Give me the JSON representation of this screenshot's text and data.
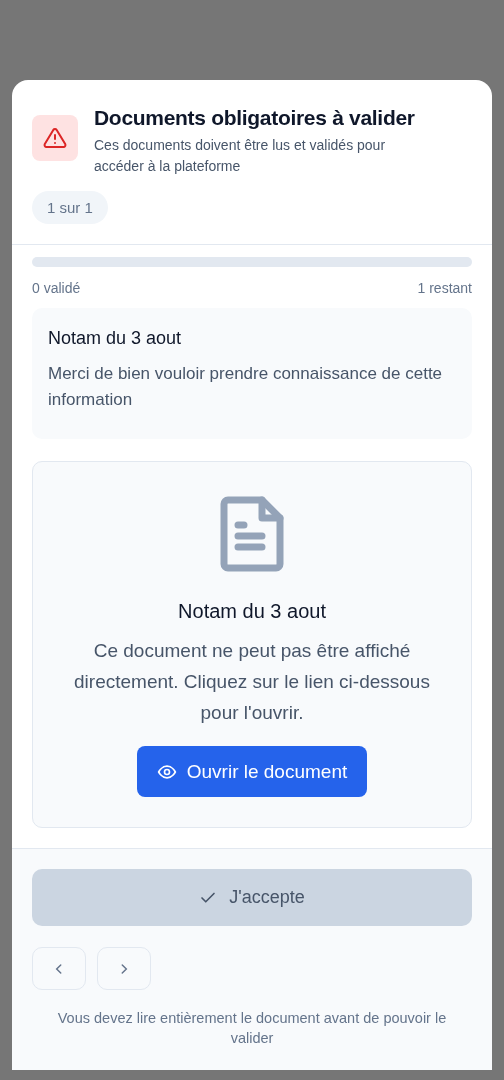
{
  "dialog": {
    "title": "Documents obligatoires à valider",
    "subtitle": "Ces documents doivent être lus et validés pour accéder à la plateforme",
    "counter": "1 sur 1"
  },
  "progress": {
    "level": 0,
    "validated": "0 validé",
    "remaining": "1 restant"
  },
  "info_card": {
    "title": "Notam du 3 aout",
    "message": "Merci de bien vouloir prendre connaissance de cette information"
  },
  "document": {
    "title": "Notam du 3 aout",
    "message": "Ce document ne peut pas être affiché directement. Cliquez sur le lien ci-dessous pour l'ouvrir.",
    "open_button": "Ouvrir le document"
  },
  "footer": {
    "accept_button": {
      "label": "J'accepte",
      "disabled": true
    },
    "note": "Vous devez lire entièrement le document avant de pouvoir le valider"
  }
}
